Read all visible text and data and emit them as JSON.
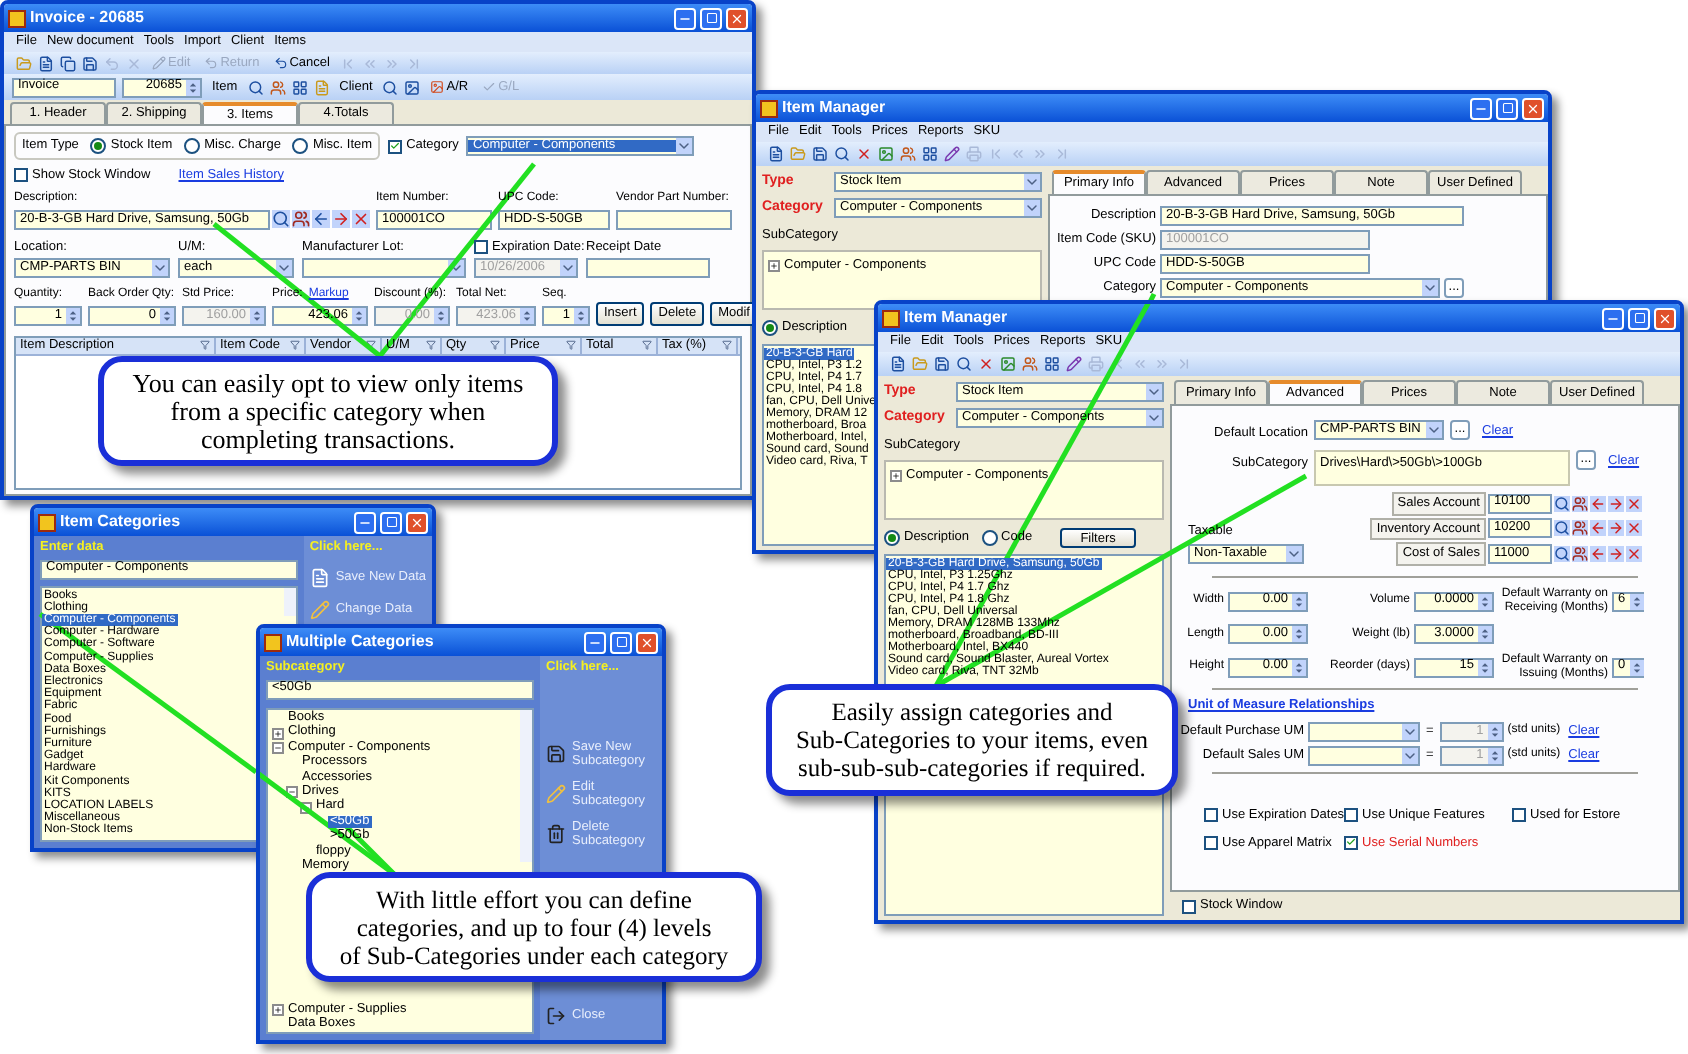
{
  "invoice": {
    "title": "Invoice - 20685",
    "menu": [
      "File",
      "New document",
      "Tools",
      "Import",
      "Client",
      "Items"
    ],
    "toolbar": [
      {
        "label": "Edit",
        "disabled": true
      },
      {
        "label": "Return",
        "disabled": true
      },
      {
        "label": "Cancel",
        "disabled": false
      }
    ],
    "document_type": "Invoice",
    "document_number": "20685",
    "toolbar2": [
      {
        "label": "Item",
        "disabled": false
      },
      {
        "label": "Client",
        "disabled": false
      },
      {
        "label": "A/R",
        "disabled": false
      },
      {
        "label": "G/L",
        "disabled": true
      }
    ],
    "tabs": [
      {
        "label": "1. Header",
        "selected": false
      },
      {
        "label": "2. Shipping",
        "selected": false
      },
      {
        "label": "3. Items",
        "selected": true
      },
      {
        "label": "4.Totals",
        "selected": false
      }
    ],
    "item_type": {
      "label": "Item Type",
      "options": [
        {
          "label": "Stock Item",
          "selected": true
        },
        {
          "label": "Misc. Charge",
          "selected": false
        },
        {
          "label": "Misc. Item",
          "selected": false
        }
      ]
    },
    "category": {
      "label": "Category",
      "checked": true,
      "value": "Computer - Components"
    },
    "show_stock_window": {
      "label": "Show Stock Window",
      "checked": false
    },
    "sales_history_link": "Item Sales History",
    "field_rows": [
      {
        "fields": [
          {
            "label": "Description:",
            "kind": "lookup",
            "value": "20-B-3-GB Hard Drive, Samsung, 50Gb"
          },
          {
            "label": "Item Number:",
            "kind": "text",
            "value": "100001CO"
          },
          {
            "label": "UPC Code:",
            "kind": "text",
            "value": "HDD-S-50GB"
          },
          {
            "label": "Vendor Part Number:",
            "kind": "text"
          }
        ]
      },
      {
        "fields": [
          {
            "label": "Location:",
            "kind": "dropdown",
            "value": "CMP-PARTS BIN"
          },
          {
            "label": "U/M:",
            "kind": "dropdown",
            "value": "each"
          },
          {
            "label": "Manufacturer Lot:",
            "kind": "dropdown"
          },
          {
            "label": "Expiration Date:",
            "kind": "dropdown",
            "checked": false,
            "value": "10/26/2006",
            "disabled": true
          },
          {
            "label": "Receipt Date",
            "kind": "text"
          }
        ]
      },
      {
        "fields": [
          {
            "label": "Quantity:",
            "kind": "spin",
            "value": "1"
          },
          {
            "label": "Back Order Qty:",
            "kind": "spin",
            "value": "0"
          },
          {
            "label": "Std Price:",
            "kind": "spin",
            "value": "160.00",
            "disabled": true
          },
          {
            "label": "Price:",
            "link": "Markup",
            "kind": "spin",
            "value": "423.06"
          },
          {
            "label": "Discount (%):",
            "kind": "spin",
            "value": "0.00",
            "disabled": true
          },
          {
            "label": "Total Net:",
            "kind": "spin",
            "value": "423.06",
            "disabled": true
          },
          {
            "label": "Seq.",
            "kind": "spin",
            "value": "1"
          }
        ]
      }
    ],
    "buttons": [
      "Insert",
      "Delete",
      "Modif"
    ],
    "grid_columns": [
      "Item Description",
      "Item Code",
      "Vendor",
      "U/M",
      "Qty",
      "Price",
      "Total",
      "Tax (%)"
    ],
    "callout": [
      "You can easily opt to view only items",
      "from a specific category when",
      "completing transactions."
    ]
  },
  "item_categories": {
    "title": "Item Categories",
    "input_label": "Enter data",
    "input_value": "Computer - Components",
    "items": [
      {
        "label": "Books",
        "selected": false
      },
      {
        "label": "Clothing",
        "selected": false
      },
      {
        "label": "Computer - Components",
        "selected": true
      },
      {
        "label": "Computer - Hardware",
        "selected": false
      },
      {
        "label": "Computer - Software",
        "selected": false
      },
      {
        "label": "Computer - Supplies",
        "selected": false
      },
      {
        "label": "Data Boxes",
        "selected": false
      },
      {
        "label": "Electronics",
        "selected": false
      },
      {
        "label": "Equipment",
        "selected": false
      },
      {
        "label": "Fabric",
        "selected": false
      },
      {
        "label": "Food",
        "selected": false
      },
      {
        "label": "Furnishings",
        "selected": false
      },
      {
        "label": "Furniture",
        "selected": false
      },
      {
        "label": "Gadget",
        "selected": false
      },
      {
        "label": "Hardware",
        "selected": false
      },
      {
        "label": "Kit Components",
        "selected": false
      },
      {
        "label": "KITS",
        "selected": false
      },
      {
        "label": "LOCATION LABELS",
        "selected": false
      },
      {
        "label": "Miscellaneous",
        "selected": false
      },
      {
        "label": "Non-Stock Items",
        "selected": false
      }
    ],
    "panel_title": "Click here...",
    "actions": [
      "Save New Data",
      "Change Data"
    ]
  },
  "multiple_categories": {
    "title": "Multiple Categories",
    "input_label": "Subcategory",
    "input_value": "<50Gb",
    "tree": [
      {
        "label": "Books",
        "selected": false
      },
      {
        "label": "Clothing",
        "expanded": false,
        "selected": false
      },
      {
        "label": "Computer - Components",
        "expanded": true,
        "selected": false,
        "children": [
          {
            "label": "Processors",
            "selected": false
          },
          {
            "label": "Accessories",
            "selected": false
          },
          {
            "label": "Drives",
            "expanded": true,
            "selected": false,
            "children": [
              {
                "label": "Hard",
                "expanded": true,
                "selected": false,
                "children": [
                  {
                    "label": "<50Gb",
                    "selected": true
                  },
                  {
                    "label": ">50Gb",
                    "selected": false
                  }
                ]
              },
              {
                "label": "floppy",
                "selected": false
              }
            ]
          },
          {
            "label": "Memory",
            "selected": false
          }
        ]
      },
      {
        "label": "Computer - Supplies",
        "expanded": false,
        "selected": false
      },
      {
        "label": "Data Boxes",
        "selected": false
      }
    ],
    "panel_title": "Click here...",
    "actions": [
      "Save New Subcategory",
      "Edit Subcategory",
      "Delete Subcategory"
    ],
    "close": "Close",
    "callout": [
      "With little effort you can define",
      "categories, and up to four (4) levels",
      "of Sub-Categories under each category"
    ]
  },
  "item_manager_back": {
    "title": "Item Manager",
    "menu": [
      "File",
      "Edit",
      "Tools",
      "Prices",
      "Reports",
      "SKU"
    ],
    "type": {
      "label": "Type",
      "value": "Stock Item"
    },
    "category": {
      "label": "Category",
      "value": "Computer - Components"
    },
    "subcategory_label": "SubCategory",
    "tree": [
      {
        "label": "Computer - Components",
        "expanded": false
      }
    ],
    "search_by": [
      {
        "label": "Description",
        "selected": true
      }
    ],
    "items": [
      {
        "label": "20-B-3-GB Hard",
        "selected": true
      },
      {
        "label": "CPU, Intel, P3 1.2",
        "selected": false
      },
      {
        "label": "CPU, Intel, P4 1.7",
        "selected": false
      },
      {
        "label": "CPU, Intel, P4 1.8",
        "selected": false
      },
      {
        "label": "fan, CPU, Dell Unive",
        "selected": false
      },
      {
        "label": "Memory, DRAM 12",
        "selected": false
      },
      {
        "label": "motherboard, Broa",
        "selected": false
      },
      {
        "label": "Motherboard, Intel,",
        "selected": false
      },
      {
        "label": "Sound card, Sound",
        "selected": false
      },
      {
        "label": "Video card, Riva, T",
        "selected": false
      }
    ],
    "tabs": [
      {
        "label": "Primary Info",
        "selected": true
      },
      {
        "label": "Advanced",
        "selected": false
      },
      {
        "label": "Prices",
        "selected": false
      },
      {
        "label": "Note",
        "selected": false
      },
      {
        "label": "User Defined",
        "selected": false
      }
    ],
    "fields": [
      {
        "label": "Description",
        "kind": "text",
        "value": "20-B-3-GB Hard Drive, Samsung, 50Gb"
      },
      {
        "label": "Item Code (SKU)",
        "kind": "text",
        "value": "100001CO",
        "disabled": true
      },
      {
        "label": "UPC Code",
        "kind": "text",
        "value": "HDD-S-50GB"
      },
      {
        "label": "Category",
        "kind": "dropdown",
        "value": "Computer - Components"
      }
    ],
    "browse_button": "..."
  },
  "item_manager": {
    "title": "Item Manager",
    "menu": [
      "File",
      "Edit",
      "Tools",
      "Prices",
      "Reports",
      "SKU"
    ],
    "type": {
      "label": "Type",
      "value": "Stock Item"
    },
    "category": {
      "label": "Category",
      "value": "Computer - Components"
    },
    "subcategory_label": "SubCategory",
    "tree": [
      {
        "label": "Computer - Components",
        "expanded": false
      }
    ],
    "search_by": [
      {
        "label": "Description",
        "selected": true
      },
      {
        "label": "Code",
        "selected": false
      }
    ],
    "filters_button": "Filters",
    "items": [
      {
        "label": "20-B-3-GB Hard Drive, Samsung, 50Gb",
        "selected": true
      },
      {
        "label": "CPU, Intel, P3 1.25Ghz",
        "selected": false
      },
      {
        "label": "CPU, Intel, P4 1.7 Ghz",
        "selected": false
      },
      {
        "label": "CPU, Intel, P4 1.8 Ghz",
        "selected": false
      },
      {
        "label": "fan, CPU, Dell Universal",
        "selected": false
      },
      {
        "label": "Memory, DRAM 128MB 133Mhz",
        "selected": false
      },
      {
        "label": "motherboard, Broadband, BD-III",
        "selected": false
      },
      {
        "label": "Motherboard, Intel, BX440",
        "selected": false
      },
      {
        "label": "Sound card, Sound Blaster, Aureal Vortex",
        "selected": false
      },
      {
        "label": "Video card, Riva, TNT 32Mb",
        "selected": false
      }
    ],
    "tabs": [
      {
        "label": "Primary Info",
        "selected": false
      },
      {
        "label": "Advanced",
        "selected": true
      },
      {
        "label": "Prices",
        "selected": false
      },
      {
        "label": "Note",
        "selected": false
      },
      {
        "label": "User Defined",
        "selected": false
      }
    ],
    "default_location": {
      "label": "Default Location",
      "value": "CMP-PARTS BIN",
      "button": "...",
      "link": "Clear"
    },
    "subcategory": {
      "label": "SubCategory",
      "value": "Drives\\Hard\\>50Gb\\>100Gb",
      "button": "...",
      "link": "Clear"
    },
    "accounts": [
      {
        "label": "Sales Account",
        "value": "10100"
      },
      {
        "label": "Inventory Account",
        "value": "10200"
      },
      {
        "label": "Cost of Sales",
        "value": "11000"
      }
    ],
    "taxable": {
      "label": "Taxable",
      "value": "Non-Taxable"
    },
    "measures": [
      {
        "label": "Width",
        "value": "0.00"
      },
      {
        "label": "Volume",
        "value": "0.0000"
      },
      {
        "label": "Default Warranty on Receiving (Months)",
        "value": "6"
      },
      {
        "label": "Length",
        "value": "0.00"
      },
      {
        "label": "Weight (lb)",
        "value": "3.0000"
      },
      {
        "label": "Height",
        "value": "0.00"
      },
      {
        "label": "Reorder (days)",
        "value": "15"
      },
      {
        "label": "Default Warranty on Issuing (Months)",
        "value": "0"
      }
    ],
    "uom_link": "Unit of Measure Relationships",
    "uom": [
      {
        "label": "Default Purchase UM",
        "equals": "=",
        "qty": "1",
        "disabled": true,
        "unit": "(std units)",
        "link": "Clear"
      },
      {
        "label": "Default Sales UM",
        "equals": "=",
        "qty": "1",
        "disabled": true,
        "unit": "(std units)",
        "link": "Clear"
      }
    ],
    "options": [
      {
        "label": "Use Expiration Dates",
        "checked": false
      },
      {
        "label": "Use Unique Features",
        "checked": false
      },
      {
        "label": "Used for Estore",
        "checked": false
      },
      {
        "label": "Use Apparel Matrix",
        "checked": false
      },
      {
        "label": "Use Serial Numbers",
        "checked": true
      }
    ],
    "stock_window": {
      "label": "Stock Window",
      "checked": false
    },
    "callout": [
      "Easily assign categories and",
      "Sub-Categories to your items, even",
      "sub-sub-sub-categories if required."
    ]
  }
}
